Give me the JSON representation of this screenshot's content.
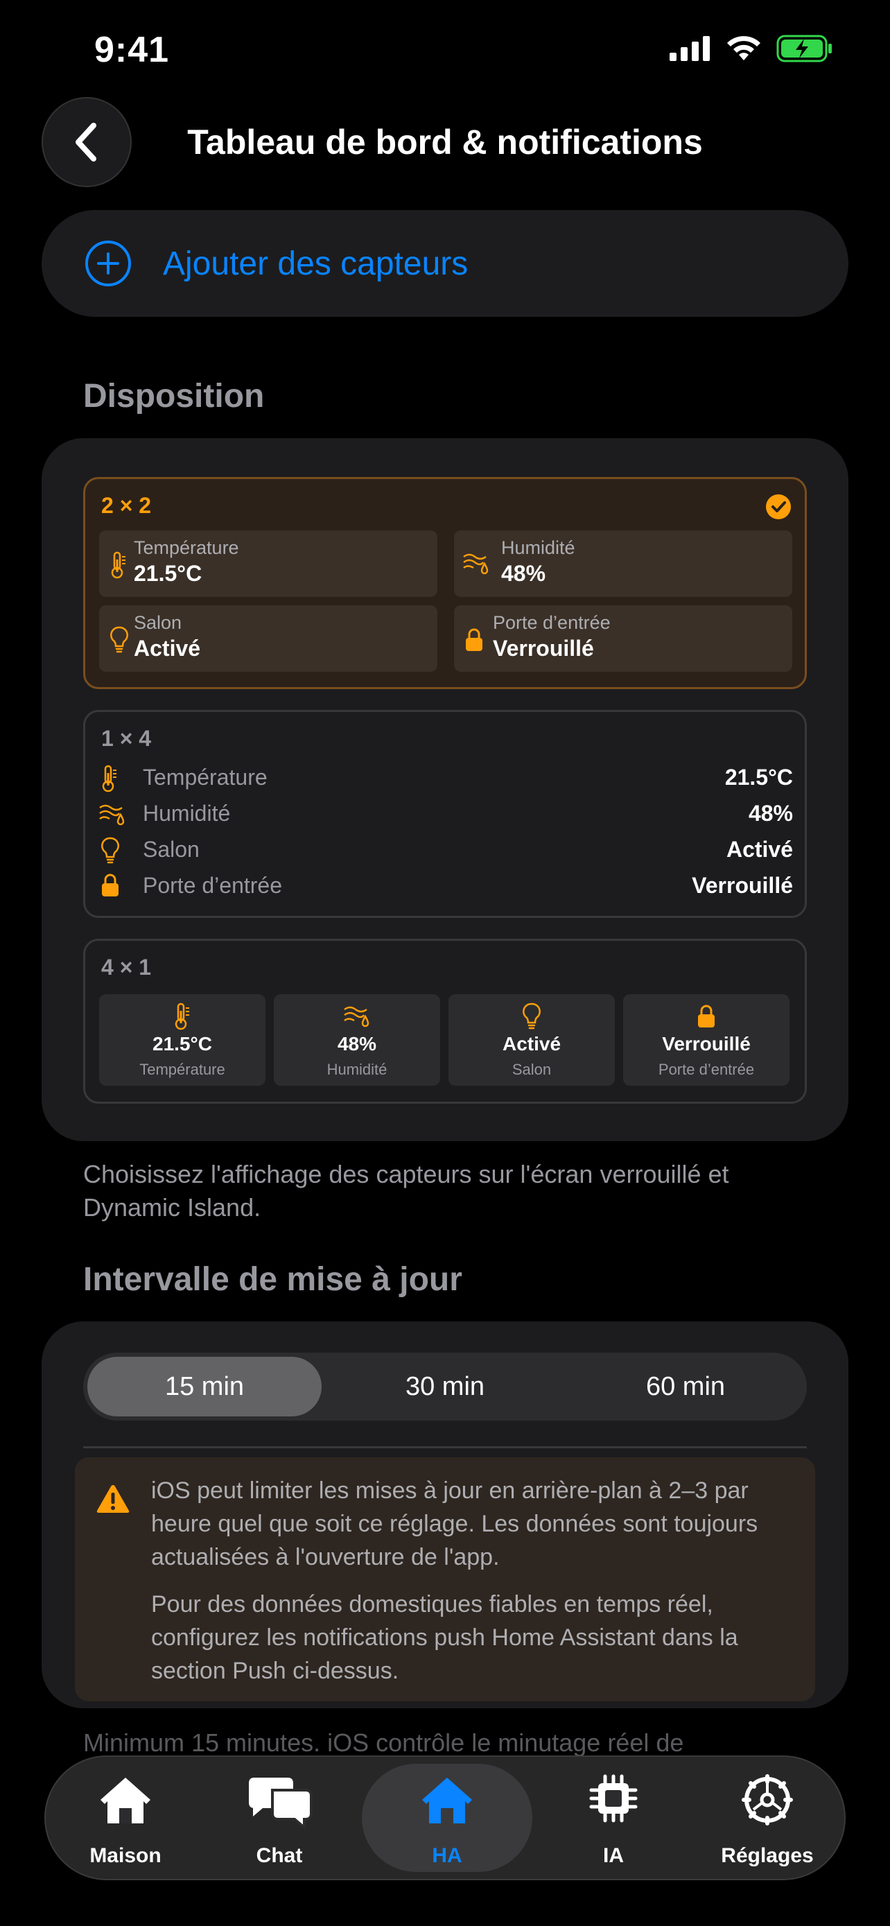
{
  "status_bar": {
    "time": "9:41"
  },
  "header": {
    "title": "Tableau de bord & notifications"
  },
  "add_sensors": {
    "label": "Ajouter des capteurs"
  },
  "disposition": {
    "section_title": "Disposition",
    "options": [
      {
        "title": "2 × 2",
        "selected": true
      },
      {
        "title": "1 × 4",
        "selected": false
      },
      {
        "title": "4 × 1",
        "selected": false
      }
    ],
    "sensors": [
      {
        "label": "Température",
        "value": "21.5°C",
        "icon": "thermometer-icon"
      },
      {
        "label": "Humidité",
        "value": "48%",
        "icon": "humidity-icon"
      },
      {
        "label": "Salon",
        "value": "Activé",
        "icon": "lightbulb-icon"
      },
      {
        "label": "Porte d’entrée",
        "value": "Verrouillé",
        "icon": "lock-icon"
      }
    ],
    "footnote": "Choisissez l'affichage des capteurs sur l'écran verrouillé et Dynamic Island."
  },
  "interval": {
    "section_title": "Intervalle de mise à jour",
    "options": [
      "15 min",
      "30 min",
      "60 min"
    ],
    "selected": "15 min",
    "warning_p1": "iOS peut limiter les mises à jour en arrière-plan à 2–3 par heure quel que soit ce réglage. Les données sont toujours actualisées à l'ouverture de l'app.",
    "warning_p2": "Pour des données domestiques fiables en temps réel, configurez les notifications push Home Assistant dans la section Push ci-dessus.",
    "footnote_partial": "Minimum 15 minutes. iOS contrôle le minutage réel de"
  },
  "tab_bar": {
    "tabs": [
      {
        "label": "Maison",
        "icon": "house-icon"
      },
      {
        "label": "Chat",
        "icon": "chat-bubbles-icon"
      },
      {
        "label": "HA",
        "icon": "home-assistant-icon"
      },
      {
        "label": "IA",
        "icon": "cpu-icon"
      },
      {
        "label": "Réglages",
        "icon": "gear-icon"
      }
    ],
    "active": "HA"
  },
  "colors": {
    "accent": "#0a84ff",
    "orange": "#ff9f0a",
    "background": "#000000",
    "card": "#1c1c1e"
  }
}
